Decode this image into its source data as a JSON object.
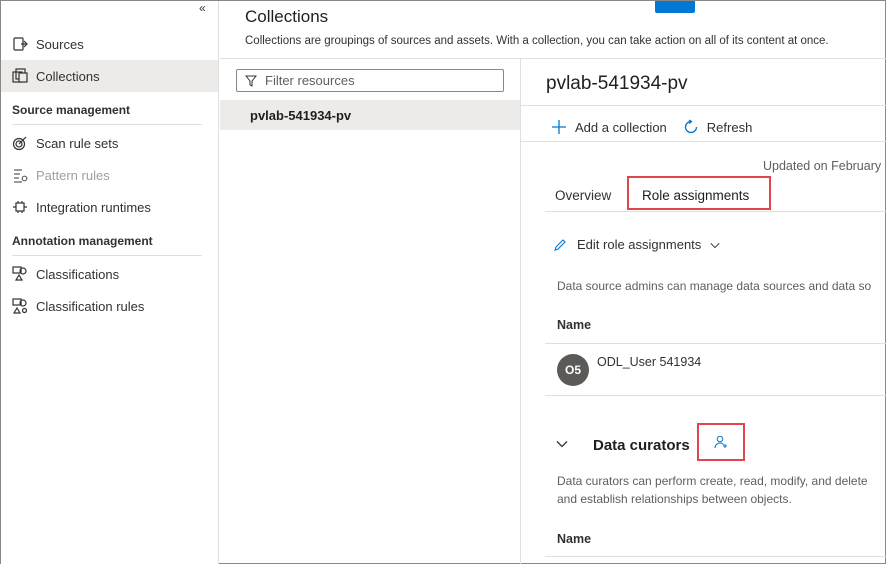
{
  "sidebar": {
    "collapse_glyph": "«",
    "items": [
      {
        "label": "Sources",
        "icon": "sources-icon"
      },
      {
        "label": "Collections",
        "icon": "collections-icon"
      }
    ],
    "sections": [
      {
        "title": "Source management",
        "items": [
          {
            "label": "Scan rule sets",
            "icon": "scan-rule-sets-icon"
          },
          {
            "label": "Pattern rules",
            "icon": "pattern-rules-icon"
          },
          {
            "label": "Integration runtimes",
            "icon": "integration-runtimes-icon"
          }
        ]
      },
      {
        "title": "Annotation management",
        "items": [
          {
            "label": "Classifications",
            "icon": "classifications-icon"
          },
          {
            "label": "Classification rules",
            "icon": "classification-rules-icon"
          }
        ]
      }
    ]
  },
  "header": {
    "title": "Collections",
    "description": "Collections are groupings of sources and assets. With a collection, you can take action on all of its content at once."
  },
  "tree": {
    "filter_placeholder": "Filter resources",
    "items": [
      {
        "label": "pvlab-541934-pv"
      }
    ]
  },
  "detail": {
    "title": "pvlab-541934-pv",
    "commands": {
      "add": "Add a collection",
      "refresh": "Refresh"
    },
    "updated": "Updated on February",
    "tabs": [
      {
        "label": "Overview"
      },
      {
        "label": "Role assignments"
      }
    ],
    "edit_label": "Edit role assignments",
    "admins_desc": "Data source admins can manage data sources and data so",
    "name_header": "Name",
    "user": {
      "initials": "O5",
      "name": "ODL_User 541934"
    },
    "curators": {
      "title": "Data curators",
      "desc_line1": "Data curators can perform create, read, modify, and delete",
      "desc_line2": "and establish relationships between objects.",
      "name_header": "Name"
    }
  },
  "colors": {
    "accent": "#0078d4",
    "highlight": "#e0474c",
    "selected": "#edebe9"
  }
}
